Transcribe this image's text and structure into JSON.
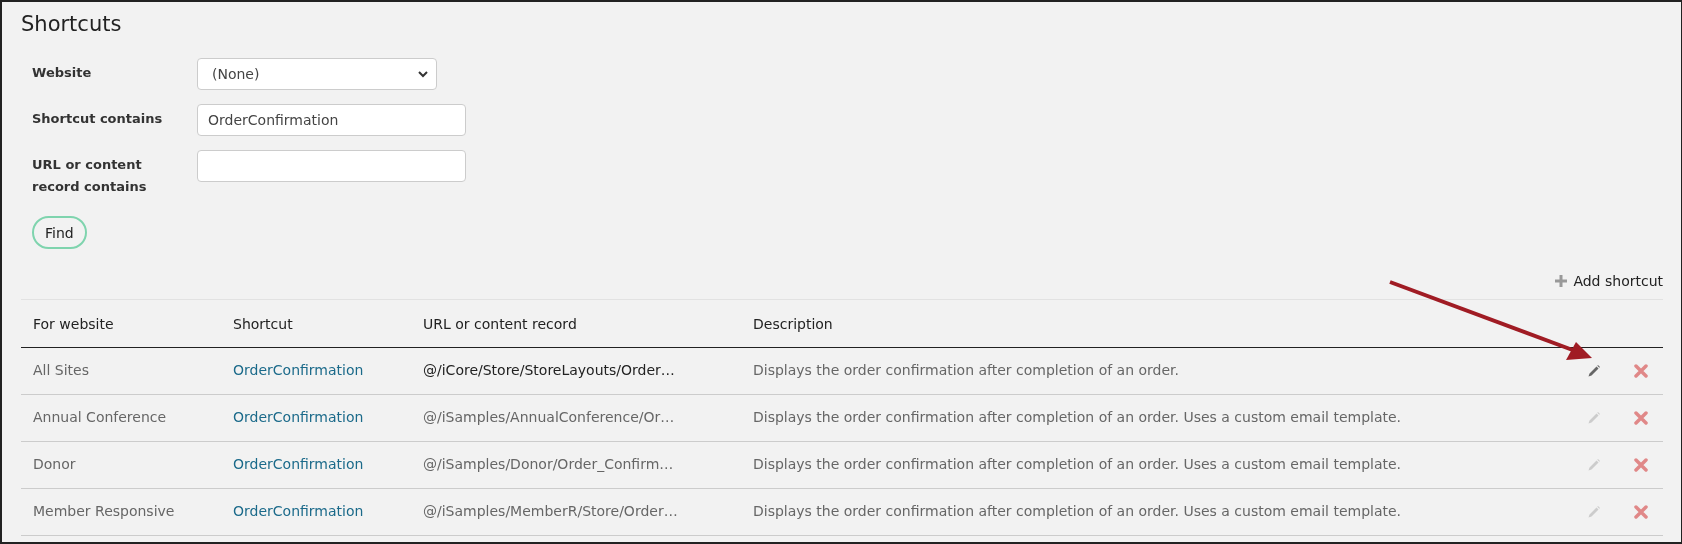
{
  "page": {
    "title": "Shortcuts"
  },
  "filters": [
    {
      "kind": "select",
      "label": "Website",
      "value": "(None)"
    },
    {
      "kind": "text",
      "label": "Shortcut contains",
      "value": "OrderConfirmation"
    },
    {
      "kind": "text",
      "label": "URL or content record contains"
    }
  ],
  "find_button": "Find",
  "add_shortcut": "Add shortcut",
  "table": {
    "columns": [
      "For website",
      "Shortcut",
      "URL or content record",
      "Description"
    ],
    "rows": [
      {
        "website": "All Sites",
        "shortcut": "OrderConfirmation",
        "url": "@/iCore/Store/StoreLayouts/Order…",
        "description": "Displays the order confirmation after completion of an order.",
        "highlighted": true
      },
      {
        "website": "Annual Conference",
        "shortcut": "OrderConfirmation",
        "url": "@/iSamples/AnnualConference/Or…",
        "description": "Displays the order confirmation after completion of an order. Uses a custom email template.",
        "highlighted": false
      },
      {
        "website": "Donor",
        "shortcut": "OrderConfirmation",
        "url": "@/iSamples/Donor/Order_Confirm…",
        "description": "Displays the order confirmation after completion of an order. Uses a custom email template.",
        "highlighted": false
      },
      {
        "website": "Member Responsive",
        "shortcut": "OrderConfirmation",
        "url": "@/iSamples/MemberR/Store/Order…",
        "description": "Displays the order confirmation after completion of an order. Uses a custom email template.",
        "highlighted": false
      }
    ]
  }
}
